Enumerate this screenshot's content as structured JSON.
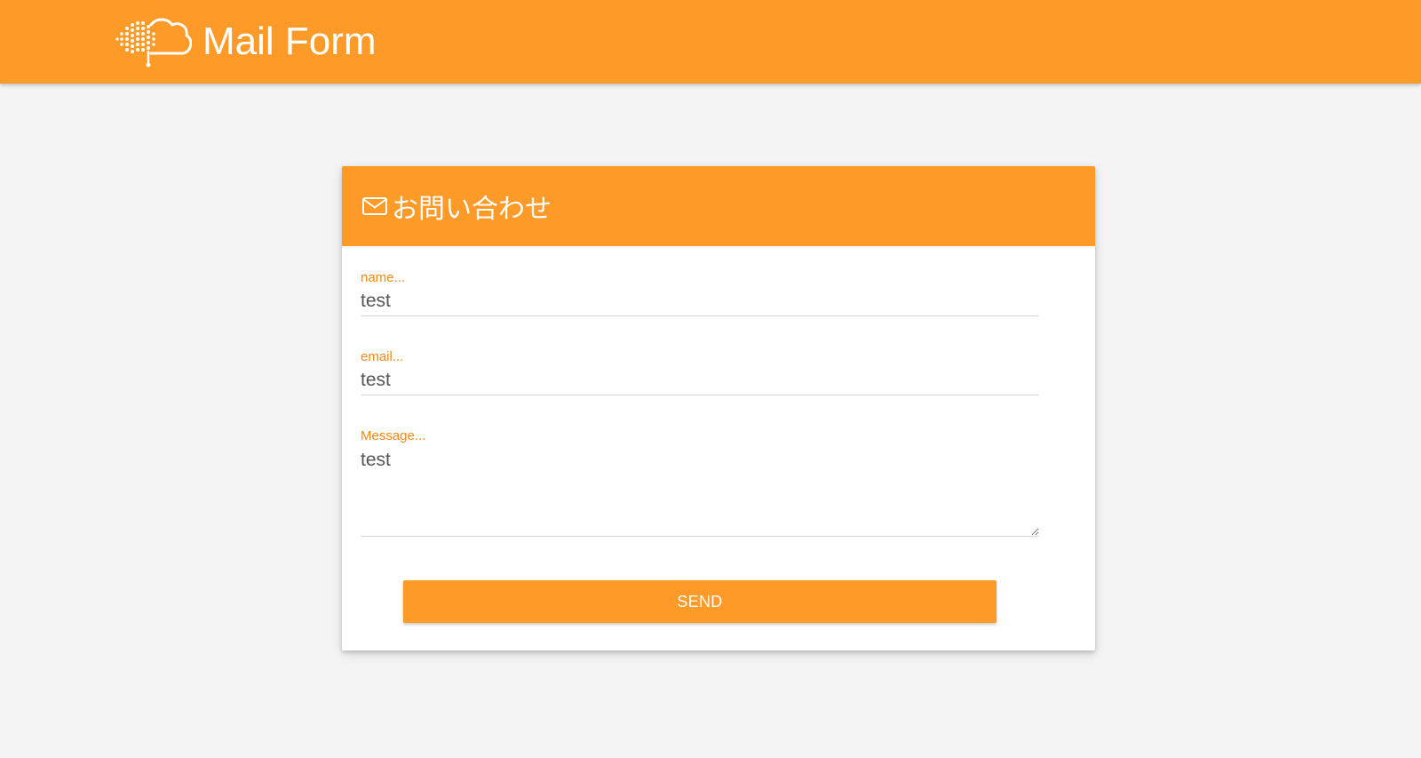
{
  "header": {
    "logo_icon": "cloud-dots-logo-icon",
    "title": "Mail Form",
    "background_color": "#fd9a28"
  },
  "card": {
    "title_icon": "mail-icon",
    "title": "お問い合わせ",
    "header_color": "#fd9a28",
    "fields": {
      "name": {
        "label": "name...",
        "value": "test"
      },
      "email": {
        "label": "email...",
        "value": "test"
      },
      "message": {
        "label": "Message...",
        "value": "test"
      }
    },
    "send_label": "SEND"
  },
  "colors": {
    "accent": "#fd9a28",
    "label": "#f08a13",
    "page_background": "#f4f4f4"
  }
}
